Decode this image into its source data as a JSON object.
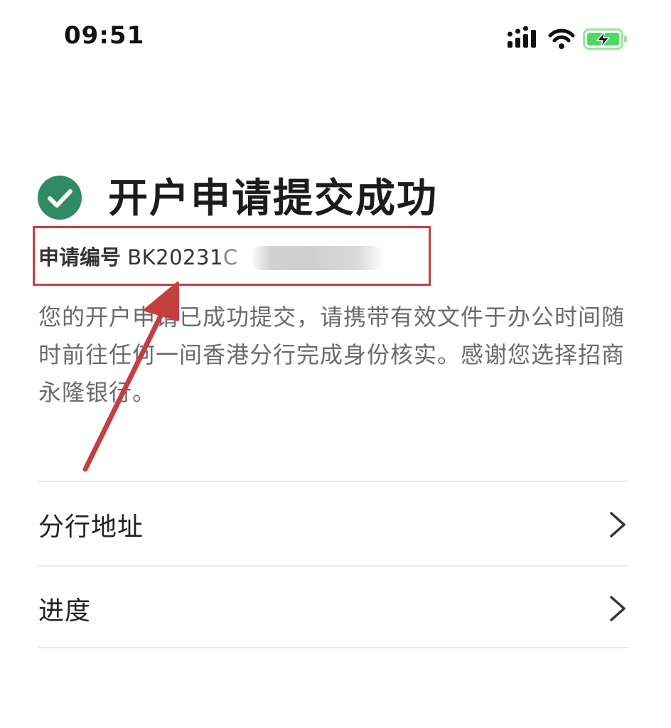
{
  "status_bar": {
    "time": "09:51",
    "icons": [
      "signal-icon",
      "wifi-icon",
      "battery-charging-icon"
    ],
    "battery_color": "#4cd964"
  },
  "header": {
    "success_icon": "check-circle-icon",
    "success_color": "#2e8b66",
    "title": "开户申请提交成功"
  },
  "application": {
    "label": "申请编号",
    "number_visible": "BK20231",
    "number_partial": "C",
    "redacted": true,
    "highlight_color": "#c4403e"
  },
  "description": "您的开户申请已成功提交，请携带有效文件于办公时间随时前往任何一间香港分行完成身份核实。感谢您选择招商永隆银行。",
  "menu": {
    "items": [
      {
        "label": "分行地址",
        "icon": "chevron-right-icon"
      },
      {
        "label": "进度",
        "icon": "chevron-right-icon"
      }
    ]
  }
}
